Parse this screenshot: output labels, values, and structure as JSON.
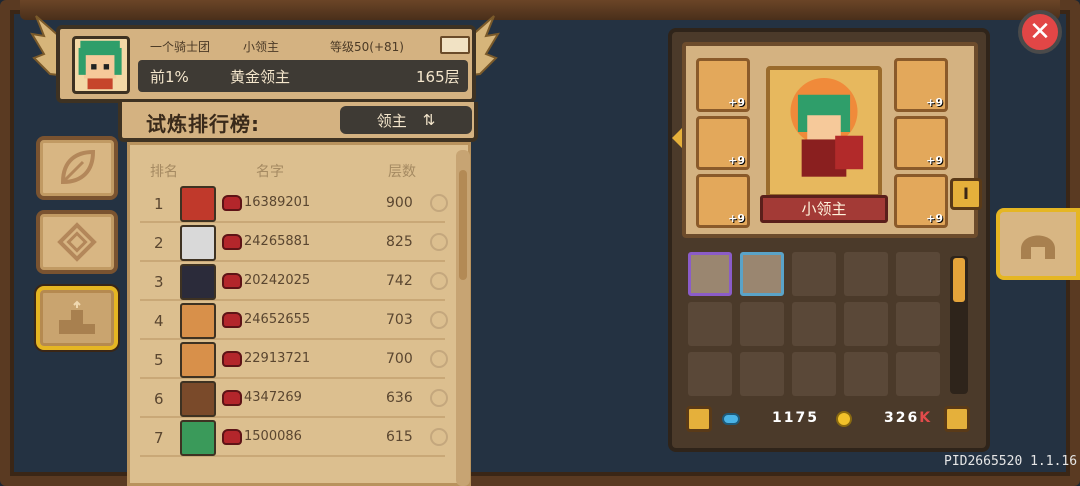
{
  "header": {
    "guild": "一个骑士团",
    "title_small": "小领主",
    "level": "等级50(+81)",
    "percentile": "前1%",
    "rank_title": "黄金领主",
    "floor": "165层"
  },
  "leaderboard": {
    "title": "试炼排行榜:",
    "filter_label": "领主",
    "filter_icon": "swap-icon",
    "columns": [
      "排名",
      "名字",
      "层数"
    ],
    "rows": [
      {
        "rank": "1",
        "uid": "16389201",
        "floor": "900",
        "face_color": "#c0392b"
      },
      {
        "rank": "2",
        "uid": "24265881",
        "floor": "825",
        "face_color": "#d9d9d9"
      },
      {
        "rank": "3",
        "uid": "20242025",
        "floor": "742",
        "face_color": "#2b2b3a"
      },
      {
        "rank": "4",
        "uid": "24652655",
        "floor": "703",
        "face_color": "#d8904a"
      },
      {
        "rank": "5",
        "uid": "22913721",
        "floor": "700",
        "face_color": "#d8904a"
      },
      {
        "rank": "6",
        "uid": "4347269",
        "floor": "636",
        "face_color": "#7a4a2a"
      },
      {
        "rank": "7",
        "uid": "1500086",
        "floor": "615",
        "face_color": "#3a9a5a"
      }
    ]
  },
  "hero": {
    "name": "小领主",
    "slot_bonus": "+9"
  },
  "currency": {
    "gems": "1175",
    "gold": "326",
    "gold_suffix": "K"
  },
  "footer": {
    "version": "PID2665520 1.1.16"
  },
  "colors": {
    "accent_gold": "#e5b623",
    "panel_tan": "#d4b281",
    "close_red": "#e24646"
  }
}
